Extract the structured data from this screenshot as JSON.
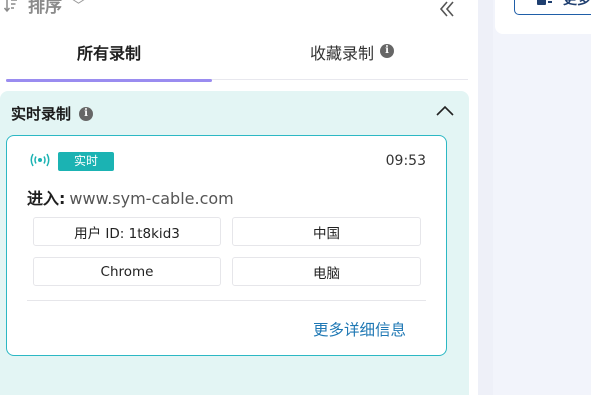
{
  "toolbar": {
    "sort_label": "排序",
    "sort_chevron": "﹀",
    "collapse_glyph": "《"
  },
  "tabs": [
    {
      "label": "所有录制",
      "active": true
    },
    {
      "label": "收藏录制",
      "active": false
    }
  ],
  "section": {
    "title": "实时录制"
  },
  "card": {
    "badge": "实时",
    "time": "09:53",
    "visit_label": "进入:",
    "visit_url": "www.sym-cable.com",
    "chips": [
      "用户 ID: 1t8kid3",
      "中国",
      "Chrome",
      "电脑"
    ],
    "more_link": "更多详细信息"
  },
  "right": {
    "button_label": "更多"
  },
  "colors": {
    "accent_teal": "#1bb3b3",
    "card_border": "#2cb8c4",
    "section_bg": "#e3f5f4",
    "tab_underline": "#9a8cf0",
    "link_blue": "#1f78b4"
  },
  "icons": {
    "sort": "sort-icon",
    "collapse": "double-chevron-left-icon",
    "info": "info-icon",
    "caret_up": "chevron-up-icon",
    "live": "broadcast-signal-icon"
  }
}
